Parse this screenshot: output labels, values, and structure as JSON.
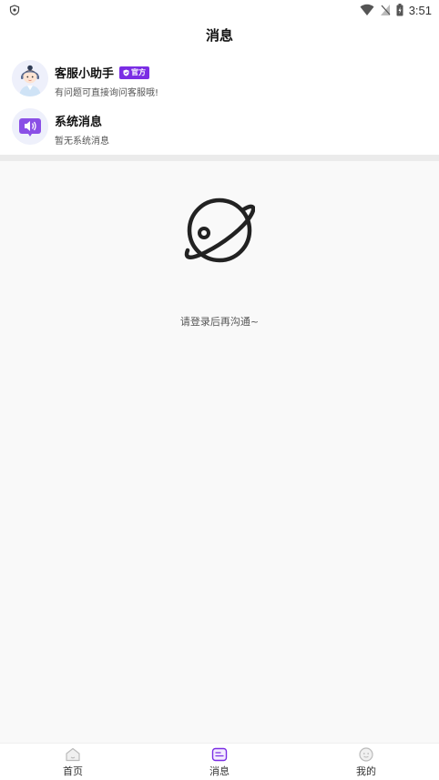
{
  "status_bar": {
    "time": "3:51"
  },
  "header": {
    "title": "消息"
  },
  "messages": [
    {
      "title": "客服小助手",
      "badge": "官方",
      "subtitle": "有问题可直接询问客服哦!"
    },
    {
      "title": "系统消息",
      "subtitle": "暂无系统消息"
    }
  ],
  "empty_state": {
    "text": "请登录后再沟通~"
  },
  "tabbar": {
    "items": [
      {
        "label": "首页",
        "icon": "home-icon"
      },
      {
        "label": "消息",
        "icon": "message-icon"
      },
      {
        "label": "我的",
        "icon": "profile-icon"
      }
    ],
    "active_index": 1
  },
  "colors": {
    "accent": "#7a2de4",
    "background": "#f9f9f9",
    "divider": "#ebebeb"
  }
}
